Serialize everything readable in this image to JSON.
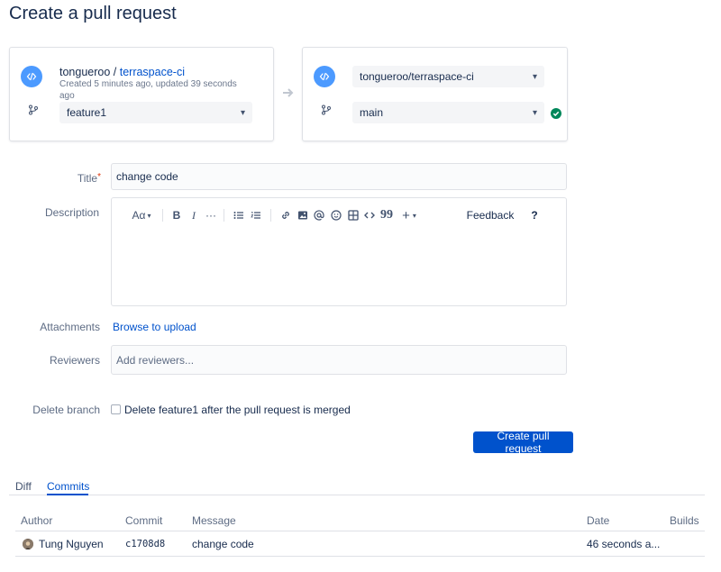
{
  "page": {
    "title": "Create a pull request"
  },
  "source": {
    "owner": "tongueroo",
    "separator": " / ",
    "repo": "terraspace-ci",
    "meta": "Created 5 minutes ago, updated 39 seconds ago",
    "branch": "feature1"
  },
  "destination": {
    "repo": "tongueroo/terraspace-ci",
    "branch": "main"
  },
  "form": {
    "title_label": "Title",
    "title_required": "*",
    "title_value": "change code",
    "description_label": "Description",
    "attachments_label": "Attachments",
    "attachments_link": "Browse to upload",
    "reviewers_label": "Reviewers",
    "reviewers_placeholder": "Add reviewers...",
    "delete_branch_label": "Delete branch",
    "delete_branch_text": "Delete feature1 after the pull request is merged",
    "submit_label": "Create pull request"
  },
  "editor_toolbar": {
    "text_style": "Aα",
    "bold": "B",
    "italic": "I",
    "more": "···",
    "add": "+",
    "quote": "99",
    "feedback": "Feedback",
    "help": "?"
  },
  "tabs": [
    {
      "label": "Diff"
    },
    {
      "label": "Commits",
      "active": true
    }
  ],
  "commits_table": {
    "headers": [
      "Author",
      "Commit",
      "Message",
      "Date",
      "Builds"
    ],
    "rows": [
      {
        "author": "Tung Nguyen",
        "commit": "c1708d8",
        "message": "change code",
        "date": "46 seconds a...",
        "builds": ""
      }
    ]
  },
  "colors": {
    "primary": "#0052cc",
    "repo_icon": "#4c9aff",
    "success": "#00875a"
  }
}
